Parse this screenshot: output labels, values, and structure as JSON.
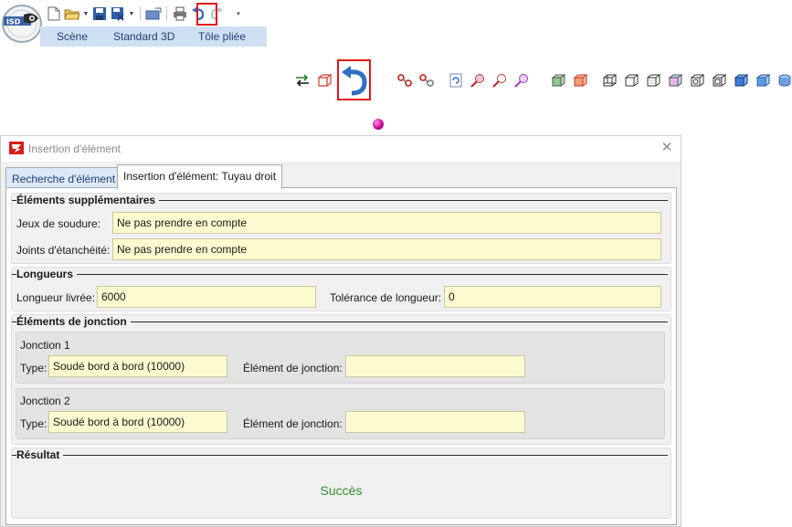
{
  "logo": {
    "text": "ISD"
  },
  "ribbon": {
    "tabs": [
      "Scène",
      "Standard 3D",
      "Tôle pliée"
    ]
  },
  "colors": {
    "accent": "#e01818",
    "field_bg": "#fbfbcf",
    "ribbon": "#cfe0f3",
    "success": "#2f8f2f"
  },
  "dialog": {
    "title": "Insertion d'élément",
    "tabs": {
      "search": "Recherche d'élément",
      "insert": "Insertion d'élément: Tuyau droit"
    },
    "extra": {
      "legend": "Éléments supplémentaires",
      "weld_label": "Jeux de soudure:",
      "weld_value": "Ne pas prendre en compte",
      "seal_label": "Joints d'étanchéité:",
      "seal_value": "Ne pas prendre en compte"
    },
    "lengths": {
      "legend": "Longueurs",
      "delivered_label": "Longueur livrée:",
      "delivered_value": "6000",
      "tolerance_label": "Tolérance de longueur:",
      "tolerance_value": "0"
    },
    "junctions": {
      "legend": "Éléments de jonction",
      "j1": {
        "title": "Jonction 1",
        "type_label": "Type:",
        "type_value": "Soudé bord à bord (10000)",
        "elem_label": "Élément de jonction:",
        "elem_value": ""
      },
      "j2": {
        "title": "Jonction 2",
        "type_label": "Type:",
        "type_value": "Soudé bord à bord (10000)",
        "elem_label": "Élément de jonction:",
        "elem_value": ""
      }
    },
    "result": {
      "legend": "Résultat",
      "status": "Succès"
    }
  }
}
